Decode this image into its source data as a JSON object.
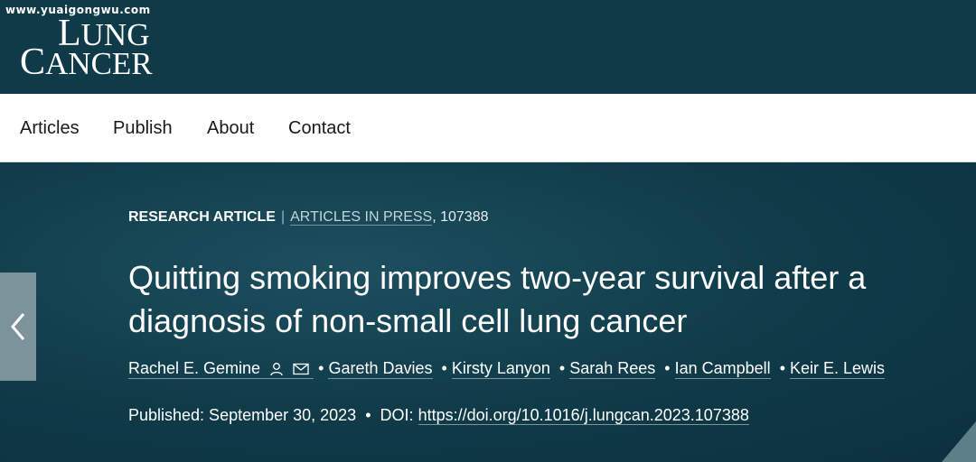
{
  "watermark": "www.yuaigongwu.com",
  "logo": {
    "first": "L",
    "first_rest": "UNG",
    "second": "C",
    "second_rest": "ANCER"
  },
  "nav": {
    "items": [
      "Articles",
      "Publish",
      "About",
      "Contact"
    ]
  },
  "article": {
    "type": "RESEARCH ARTICLE",
    "separator": "|",
    "status": "ARTICLES IN PRESS",
    "number": ", 107388",
    "title": "Quitting smoking improves two-year survival after a diagnosis of non-small cell lung cancer",
    "authors": [
      "Rachel E. Gemine",
      "Gareth Davies",
      "Kirsty Lanyon",
      "Sarah Rees",
      "Ian Campbell",
      "Keir E. Lewis"
    ],
    "published_label": "Published: September 30, 2023",
    "doi_label": "DOI:",
    "doi_url": "https://doi.org/10.1016/j.lungcan.2023.107388"
  },
  "icons": {
    "prev": "chevron-left-icon",
    "person": "person-icon",
    "mail": "mail-icon"
  },
  "colors": {
    "header_bg": "#0f3a48",
    "hero_bg": "#0f3a48",
    "nav_bg": "#ffffff",
    "carousel_btn": "#7d939b"
  }
}
